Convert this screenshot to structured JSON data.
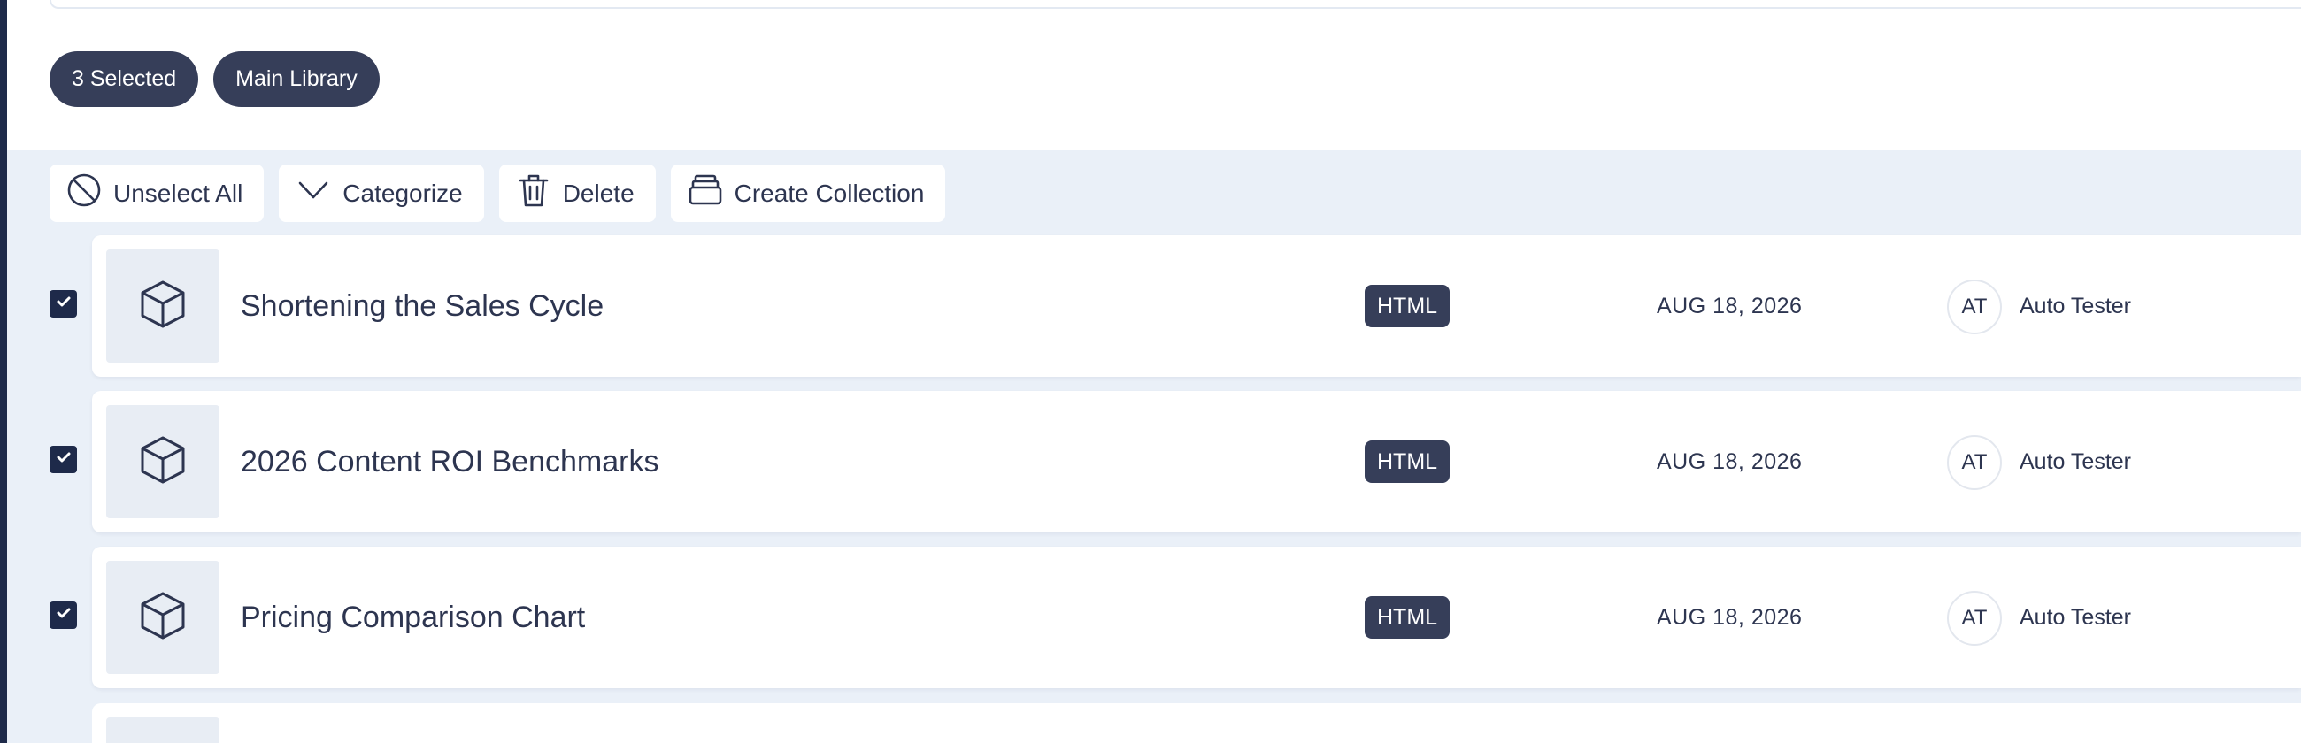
{
  "selection": {
    "count_label": "3 Selected",
    "library_label": "Main Library"
  },
  "toolbar": {
    "unselect_all": "Unselect All",
    "categorize": "Categorize",
    "delete": "Delete",
    "create_collection": "Create Collection"
  },
  "items": [
    {
      "title": "Shortening the Sales Cycle",
      "type": "HTML",
      "date": "AUG 18, 2026",
      "owner_initials": "AT",
      "owner": "Auto Tester",
      "checked": true
    },
    {
      "title": "2026 Content ROI Benchmarks",
      "type": "HTML",
      "date": "AUG 18, 2026",
      "owner_initials": "AT",
      "owner": "Auto Tester",
      "checked": true
    },
    {
      "title": "Pricing Comparison Chart",
      "type": "HTML",
      "date": "AUG 18, 2026",
      "owner_initials": "AT",
      "owner": "Auto Tester",
      "checked": true
    }
  ],
  "icons": {
    "unselect": "ban-icon",
    "categorize": "chevron-down-icon",
    "delete": "trash-icon",
    "collection": "stack-icon",
    "thumbnail": "cube-icon",
    "checkbox": "check-icon"
  },
  "colors": {
    "accent_dark": "#363e59",
    "checkbox": "#1e2a4a",
    "list_background": "#eaf0f8",
    "thumbnail_background": "#e8edf4"
  }
}
